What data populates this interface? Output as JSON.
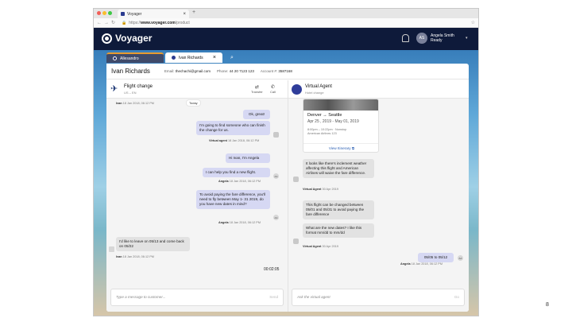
{
  "browser": {
    "tab_title": "Voyager",
    "new_tab": "+",
    "url_prefix": "https://",
    "url_host": "www.voyager.com",
    "url_path": "/product"
  },
  "app": {
    "logo": "Voyager",
    "user_initials": "AS",
    "user_name": "Angela Smith",
    "user_status": "Ready"
  },
  "tabs": [
    {
      "label": "Allesandro"
    },
    {
      "label": "Ivan Richards"
    }
  ],
  "customer": {
    "name": "Ivan Richards",
    "email_label": "Email:",
    "email": "thechachi@gmail.com",
    "phone_label": "Phone:",
    "phone": "44 20 7123 123",
    "account_label": "Account #:",
    "account": "3587168"
  },
  "case": {
    "title": "Flight change",
    "locale": "US – EN",
    "transfer": "Transfer",
    "call": "Call"
  },
  "virtual_agent": {
    "title": "Virtual Agent",
    "subtitle": "Hotel change"
  },
  "today": "Today",
  "left_messages": [
    {
      "meta_name": "Ivan",
      "meta_time": "18 Jan 2018, 06:12 PM"
    },
    {
      "text": "Ok, great!"
    },
    {
      "text": "I'm going to find someone who can finish the change for us.",
      "meta_name": "Virtual agent",
      "meta_time": "18 Jan 2018, 06:12 PM"
    },
    {
      "text": "Hi Ivan, I'm Angela"
    },
    {
      "text": "I can help you find a new flight.",
      "meta_name": "Angela",
      "meta_time": "18 Jan 2018, 06:12 PM",
      "avatar": "AA"
    },
    {
      "text": "To avoid paying the fare difference, you'll need to fly between May 1- 31 2019, do you have new dates in mind?",
      "meta_name": "Angela",
      "meta_time": "18 Jan 2018, 06:12 PM",
      "avatar": "AA"
    },
    {
      "text": "I'd like to leave on 05/13 and come back on 05/22",
      "meta_name": "Ivan",
      "meta_time": "18 Jan 2018, 06:12 PM"
    }
  ],
  "timer": "00:02:05",
  "composer_left": {
    "placeholder": "Type a message to customer...",
    "send": "Send"
  },
  "composer_right": {
    "placeholder": "Ask the virtual agent",
    "send": "Go"
  },
  "flight_card": {
    "route_from": "Denver",
    "route_arrow": "→",
    "route_to": "Seattle",
    "dates": "Apr 25 , 2019 - May 01, 2019",
    "time": "8:00pm – 10:22pm · Nonstop",
    "airline": "American Airlines 123",
    "itinerary": "View Itinerary"
  },
  "right_messages": [
    {
      "text": "It looks like there's inclement weather affecting this flight and American Airlines will waive the fare difference.",
      "meta_name": "Virtual Agent",
      "meta_time": "30 Apr 2019"
    },
    {
      "text": "This flight can be changed between 05/01 and 05/31 to avoid paying the fare difference"
    },
    {
      "text": "What are the new dates? I like this format mm/dd to mm/dd",
      "meta_name": "Virtual Agent",
      "meta_time": "30 Apr 2019"
    },
    {
      "text": "05/05 to 05/12",
      "meta_name": "Angela",
      "meta_time": "18 Jan 2018, 06:12 PM",
      "avatar": "AA"
    }
  ],
  "page_number": "8",
  "colors": {
    "navy": "#0e1a3a",
    "bubble_agent": "#d6d8f3",
    "bubble_customer": "#e2e2e2",
    "accent_tab": "#e89b2f",
    "link": "#2b5fb3"
  }
}
